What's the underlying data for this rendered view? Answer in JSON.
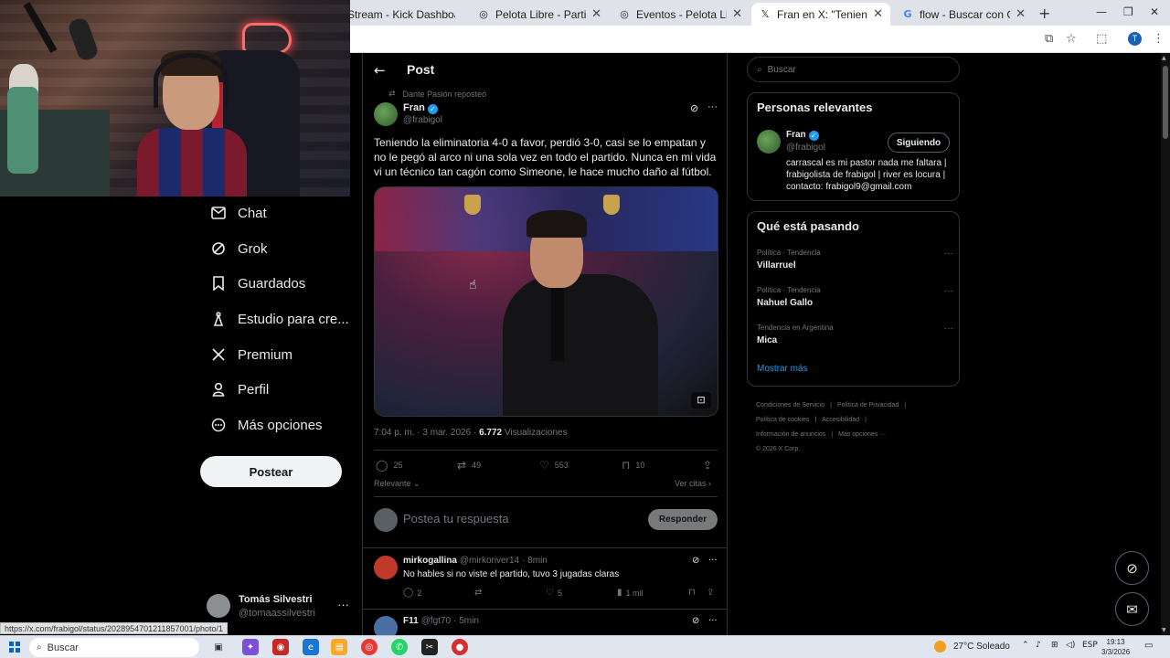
{
  "browser": {
    "tabs": [
      {
        "title": "Stream - Kick Dashboard",
        "icon": "kick-icon"
      },
      {
        "title": "Pelota Libre - Partidos de Fútb",
        "icon": "globe-icon"
      },
      {
        "title": "Eventos - Pelota Libre TV",
        "icon": "globe-icon"
      },
      {
        "title": "Fran en X: \"Teniendo la elimin",
        "icon": "x-logo-icon"
      },
      {
        "title": "flow - Buscar con Google",
        "icon": "google-icon"
      }
    ],
    "new_tab": "+",
    "minimize": "—",
    "restore": "❐",
    "close": "✕",
    "profile_initial": "T",
    "status_url": "https://x.com/frabigol/status/2028954701211857001/photo/1"
  },
  "nav": {
    "items": [
      {
        "label": "Chat",
        "icon": "mail-icon"
      },
      {
        "label": "Grok",
        "icon": "grok-icon"
      },
      {
        "label": "Guardados",
        "icon": "bookmark-icon"
      },
      {
        "label": "Estudio para cre...",
        "icon": "creator-studio-icon"
      },
      {
        "label": "Premium",
        "icon": "x-logo-icon"
      },
      {
        "label": "Perfil",
        "icon": "person-icon"
      },
      {
        "label": "Más opciones",
        "icon": "more-circle-icon"
      }
    ],
    "post_button": "Postear",
    "user": {
      "name": "Tomás Silvestri",
      "handle": "@tomaassilvestri",
      "more": "···"
    }
  },
  "post": {
    "header": "Post",
    "reposted_by": "Dante Pasión reposteó",
    "author": {
      "name": "Fran",
      "handle": "@frabigol",
      "verified": "✓"
    },
    "text": "Teniendo la eliminatoria 4-0 a favor, perdió 3-0, casi se lo empatan y no le pegó al arco ni una sola vez en todo el partido. Nunca en mi vida vi un técnico tan cagón como Simeone, le hace mucho daño al fútbol.",
    "time": "7:04 p. m. · 3 mar. 2026 · ",
    "views_count": "6.772",
    "views_label": " Visualizaciones",
    "actions": {
      "replies": "25",
      "reposts": "49",
      "likes": "553",
      "bookmarks": "10"
    },
    "sort_label": "Relevante",
    "quotes_label": "Ver citas",
    "reply_placeholder": "Postea tu respuesta",
    "reply_button": "Responder"
  },
  "comments": [
    {
      "name": "mirkogallina",
      "handle": "@mirkoriver14",
      "time": "· 8min",
      "text": "No hables si no viste el partido, tuvo 3 jugadas claras",
      "replies": "2",
      "reposts": "",
      "likes": "5",
      "views": "1 mil",
      "avatar_color": "#c0392b"
    },
    {
      "name": "F11",
      "handle": "@fgt70",
      "time": "· 5min",
      "text": "",
      "replies": "",
      "reposts": "",
      "likes": "",
      "views": "",
      "avatar_color": "#4a6fa5"
    }
  ],
  "right": {
    "search_placeholder": "Buscar",
    "relevant_title": "Personas relevantes",
    "relevant_person": {
      "name": "Fran",
      "handle": "@frabigol",
      "button": "Siguiendo",
      "bio": "carrascal es mi pastor nada me faltara | frabigolista de frabigol | river es locura | contacto: frabigol9@gmail.com"
    },
    "trending_title": "Qué está pasando",
    "trends": [
      {
        "category": "Política · Tendencia",
        "name": "Villarruel"
      },
      {
        "category": "Política · Tendencia",
        "name": "Nahuel Gallo"
      },
      {
        "category": "Tendencia en Argentina",
        "name": "Mica"
      }
    ],
    "show_more": "Mostrar más",
    "footer": [
      "Condiciones de Servicio",
      "|",
      "Política de Privacidad",
      "|",
      "Política de cookies",
      "|",
      "Accesibilidad",
      "|",
      "Información de anuncios",
      "|",
      "Más opciones ···",
      "© 2026 X Corp."
    ]
  },
  "taskbar": {
    "search": "Buscar",
    "weather": "27°C  Soleado",
    "lang": "ESP",
    "time": "19:13",
    "date": "3/3/2026"
  },
  "colors": {
    "accent": "#1d9bf0",
    "background": "#000000",
    "border": "#2f3336",
    "muted": "#71767b"
  }
}
